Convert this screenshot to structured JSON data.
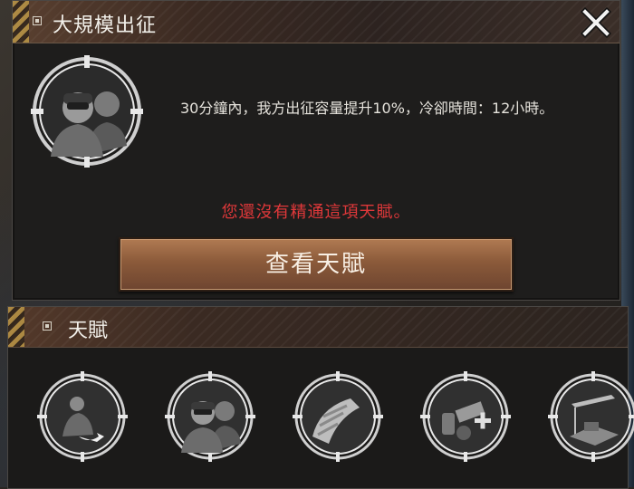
{
  "dialog": {
    "title": "大規模出征",
    "description": "30分鐘內，我方出征容量提升10%，冷卻時間：12小時。",
    "warning": "您還沒有精通這項天賦。",
    "view_button_label": "查看天賦",
    "warning_color": "#e0383a"
  },
  "talents_panel": {
    "title": "天賦",
    "items": [
      {
        "icon": "soldier-with-arrow-icon"
      },
      {
        "icon": "two-soldiers-icon"
      },
      {
        "icon": "bandaged-arm-icon"
      },
      {
        "icon": "supply-crates-icon"
      },
      {
        "icon": "construction-site-icon"
      }
    ]
  }
}
